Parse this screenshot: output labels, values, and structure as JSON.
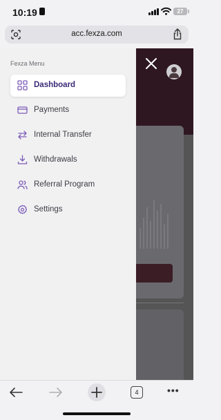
{
  "status_bar": {
    "time": "10:19",
    "battery": "27"
  },
  "address_bar": {
    "url": "acc.fexza.com"
  },
  "menu": {
    "title": "Fexza Menu",
    "items": [
      {
        "label": "Dashboard",
        "icon": "dashboard-grid-icon",
        "active": true
      },
      {
        "label": "Payments",
        "icon": "credit-card-icon",
        "active": false
      },
      {
        "label": "Internal Transfer",
        "icon": "transfer-arrows-icon",
        "active": false
      },
      {
        "label": "Withdrawals",
        "icon": "download-tray-icon",
        "active": false
      },
      {
        "label": "Referral Program",
        "icon": "users-icon",
        "active": false
      },
      {
        "label": "Settings",
        "icon": "gear-icon",
        "active": false
      }
    ]
  },
  "toolbar": {
    "tab_count": "4"
  },
  "colors": {
    "accent": "#7b5bb6",
    "active_text": "#3b2a78",
    "page_header": "#2f1721"
  }
}
